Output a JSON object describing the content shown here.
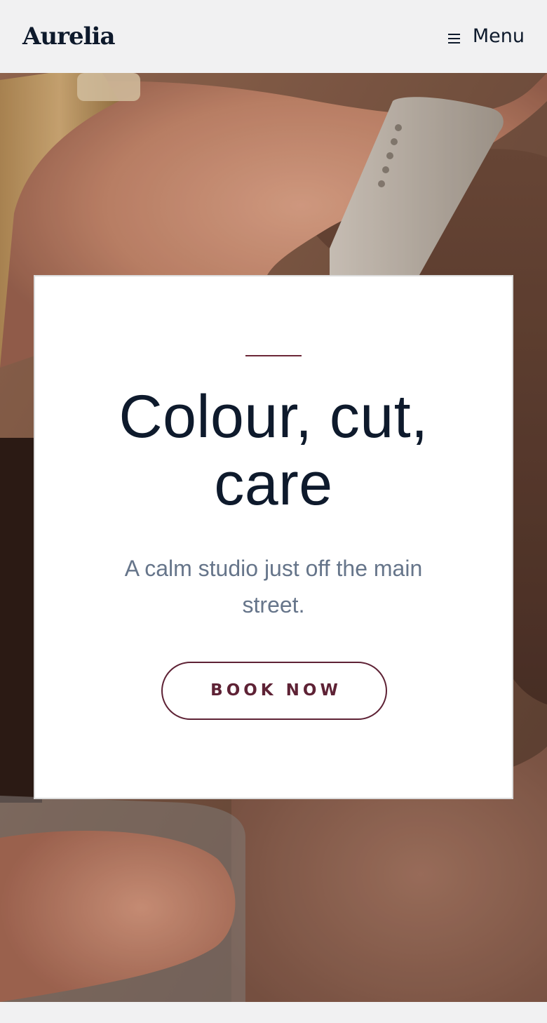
{
  "header": {
    "logo": "Aurelia",
    "menu_label": "Menu",
    "menu_icon": "hamburger-menu-icon"
  },
  "hero": {
    "image": "hero-photo-barber-combing-hair",
    "title_line1": "Colour, cut,",
    "title_line2": "care",
    "subtitle_line1": "A calm studio just off the main",
    "subtitle_line2": "street.",
    "cta_label": "BOOK NOW"
  },
  "colors": {
    "text_dark": "#0e1a2c",
    "accent_burgundy": "#5e2235",
    "subtitle_gray": "#66758a",
    "header_bg": "#f1f1f2",
    "card_bg": "#ffffff"
  }
}
